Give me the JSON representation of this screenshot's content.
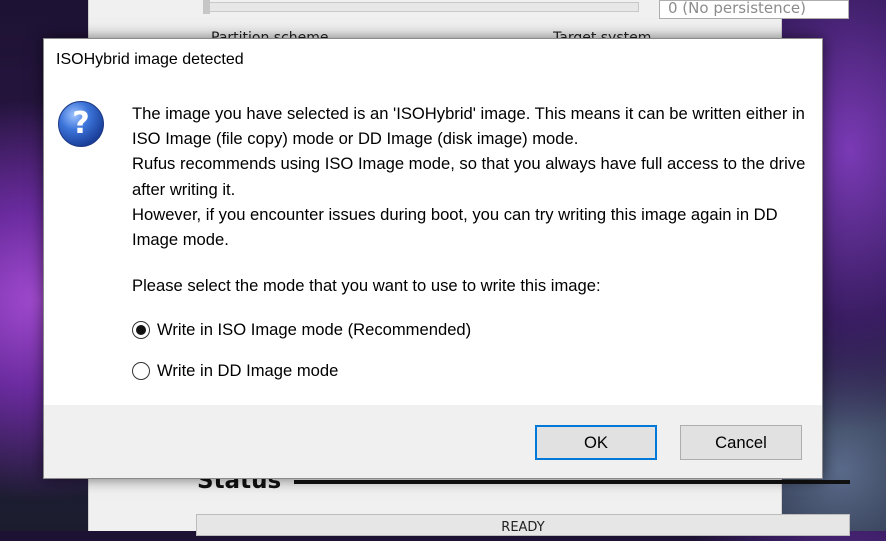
{
  "background_window": {
    "persistence_value": "0 (No persistence)",
    "partition_label": "Partition scheme",
    "target_label": "Target system",
    "status_heading": "Status",
    "progress_text": "READY"
  },
  "dialog": {
    "title": "ISOHybrid image detected",
    "icon": "question-icon",
    "message_lines": [
      "The image you have selected is an 'ISOHybrid' image. This means it can be written either in ISO Image (file copy) mode or DD Image (disk image) mode.",
      "Rufus recommends using ISO Image mode, so that you always have full access to the drive after writing it.",
      "However, if you encounter issues during boot, you can try writing this image again in DD Image mode."
    ],
    "prompt": "Please select the mode that you want to use to write this image:",
    "options": [
      {
        "label": "Write in ISO Image mode (Recommended)",
        "selected": true
      },
      {
        "label": "Write in DD Image mode",
        "selected": false
      }
    ],
    "buttons": {
      "ok": "OK",
      "cancel": "Cancel"
    },
    "accent_color": "#0078d7"
  }
}
